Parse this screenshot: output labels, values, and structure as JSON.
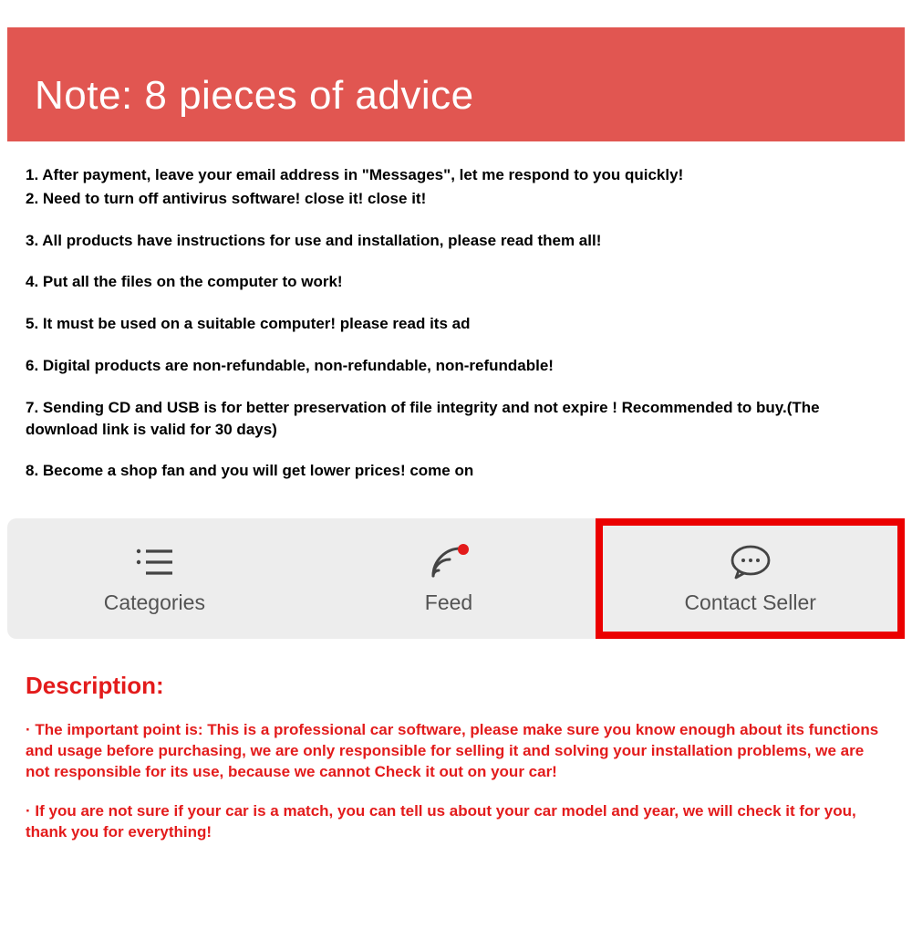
{
  "banner": {
    "title": "Note: 8 pieces of advice"
  },
  "advice": {
    "items": [
      "1. After payment, leave your email address in \"Messages\", let me respond to you quickly!",
      "2. Need to turn off antivirus software! close it! close it!",
      "3. All products have instructions for use and installation, please read them all!",
      "4. Put all the files on the computer to work!",
      "5. It must be used on a suitable computer! please read its ad",
      "6. Digital products are non-refundable, non-refundable, non-refundable!",
      "7. Sending CD and USB is for better preservation of file integrity and not expire ! Recommended to buy.(The download link is valid for 30 days)",
      "8. Become a shop fan and you will get lower prices! come on"
    ]
  },
  "nav": {
    "categories": "Categories",
    "feed": "Feed",
    "contact": "Contact Seller"
  },
  "description": {
    "title": "Description:",
    "p1": "· The important point is: This is a professional car software, please make sure you know enough about its functions and usage before purchasing, we are only responsible for selling it and solving your installation problems, we are not responsible for its use, because we cannot Check it out on your car!",
    "p2": "· If you are not sure if your car is a match, you can tell us about your car model and year, we will check it for you, thank you for everything!"
  }
}
